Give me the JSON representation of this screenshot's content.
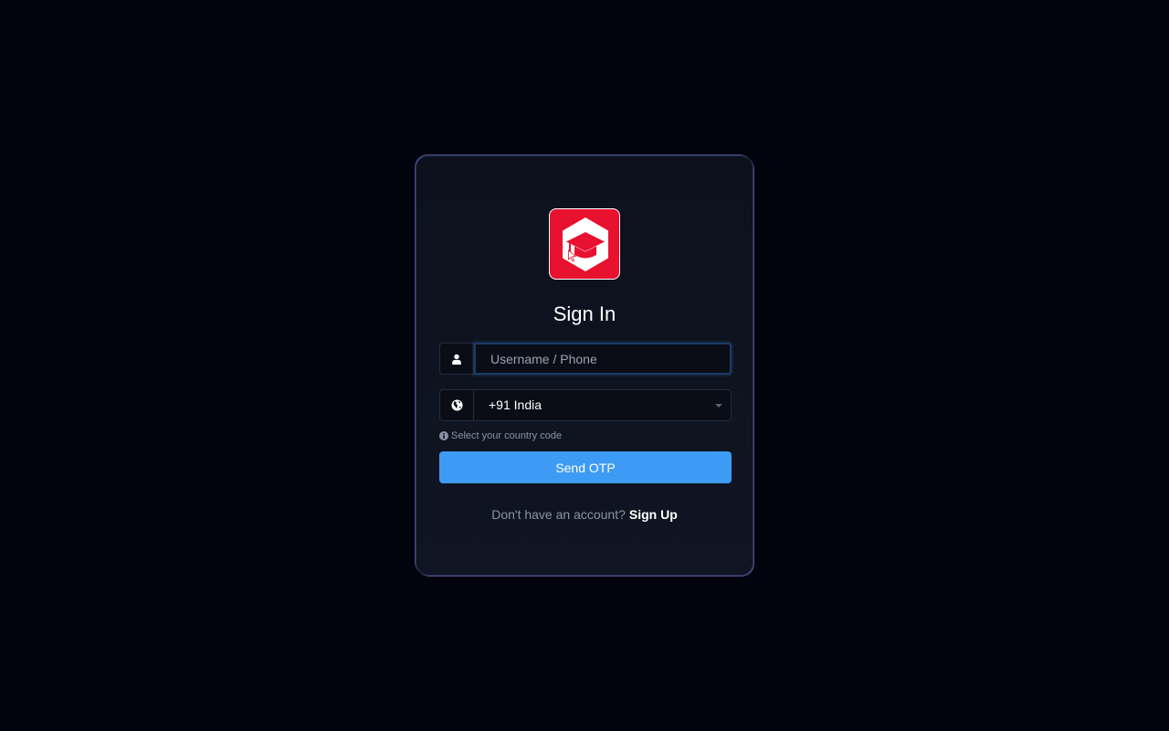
{
  "auth": {
    "title": "Sign In",
    "username_placeholder": "Username / Phone",
    "username_value": "",
    "country_selected": "+91 India",
    "country_hint": "Select your country code",
    "send_button": "Send OTP",
    "signup_prompt": "Don't have an account?",
    "signup_link": "Sign Up"
  },
  "icons": {
    "logo": "graduation-cap-hexagon-logo",
    "username": "user-icon",
    "country": "globe-icon",
    "hint": "info-icon",
    "dropdown": "caret-down-icon"
  },
  "colors": {
    "background": "#02030d",
    "card": "#0e1420",
    "logo_red": "#e8112f",
    "primary_button": "#3d9bf5",
    "muted_text": "#8a93a3"
  }
}
